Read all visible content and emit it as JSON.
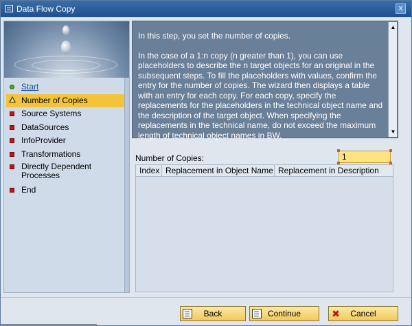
{
  "window": {
    "title": "Data Flow Copy",
    "close_label": "x"
  },
  "sidebar": {
    "steps": [
      {
        "label": "Start",
        "status": "done",
        "link": true
      },
      {
        "label": "Number of Copies",
        "status": "current"
      },
      {
        "label": "Source Systems",
        "status": "pending"
      },
      {
        "label": "DataSources",
        "status": "pending"
      },
      {
        "label": "InfoProvider",
        "status": "pending"
      },
      {
        "label": "Transformations",
        "status": "pending"
      },
      {
        "label": "Directly Dependent Processes",
        "status": "pending"
      },
      {
        "label": "End",
        "status": "pending"
      }
    ]
  },
  "info": {
    "paragraph1": "In this step, you set the number of copies.",
    "paragraph2": "In the case of a 1:n copy (n greater than 1), you can use placeholders to describe the n target objects for an original in the subsequent steps. To fill the placeholders with values, confirm the entry for the number of copies. The wizard then displays a table with an entry for each copy. For each copy, specify the replacements for the placeholders in the technical object name and the description of the target object. When specifying the replacements in the technical name, do not exceed the maximum length of technical object names in BW."
  },
  "copies": {
    "label": "Number of Copies:",
    "value": "1"
  },
  "table": {
    "columns": [
      "Index",
      "Replacement in Object Name",
      "Replacement in Description"
    ],
    "rows": []
  },
  "buttons": {
    "back": "Back",
    "continue": "Continue",
    "cancel": "Cancel"
  },
  "colors": {
    "accent": "#f3c43a",
    "title_bar": "#1e4f8e",
    "info_panel": "#6a7f98"
  }
}
